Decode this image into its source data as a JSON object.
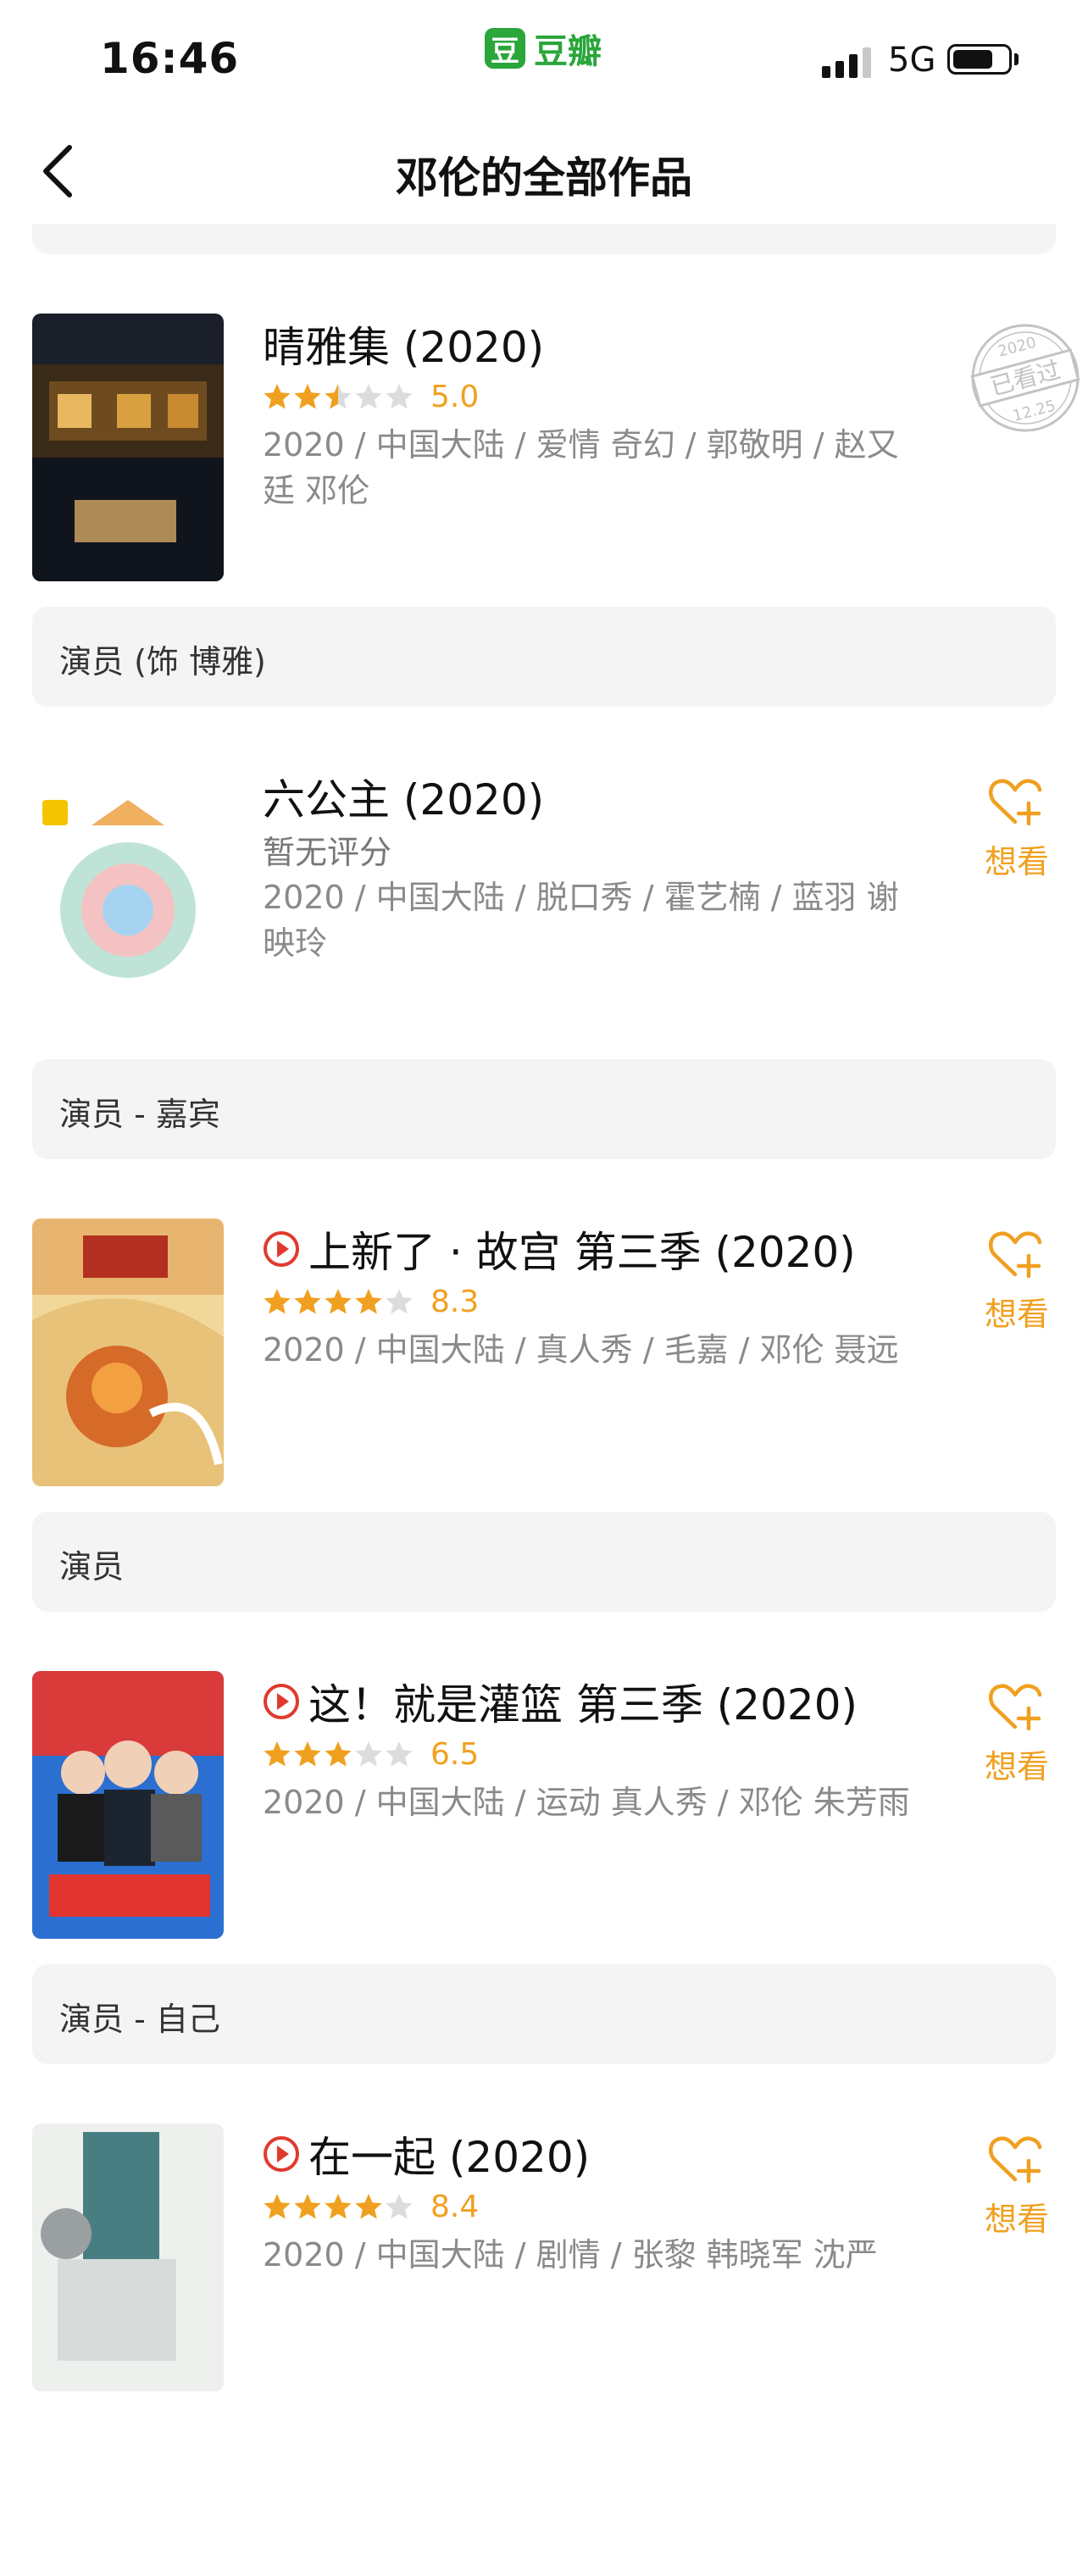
{
  "status_bar": {
    "time": "16:46",
    "app_logo_char": "豆",
    "app_name": "豆瓣",
    "network": "5G",
    "signal_bars": 3,
    "battery_level": 0.7
  },
  "header": {
    "title": "邓伦的全部作品",
    "back_icon": "chevron-left-icon"
  },
  "colors": {
    "accent_orange": "#f0a020",
    "play_red": "#e03a2f",
    "role_bg": "#f4f4f4",
    "douban_green": "#2aa63a"
  },
  "works": [
    {
      "title": "晴雅集 (2020)",
      "has_play": false,
      "rating_stars": 2.5,
      "score": "5.0",
      "no_rating_text": "",
      "meta": "2020 / 中国大陆 / 爱情 奇幻 / 郭敬明 / 赵又廷 邓伦",
      "action": "seen",
      "seen_stamp": {
        "year": "2020",
        "label": "已看过",
        "date": "12.25"
      },
      "want_label": "",
      "role": "演员 (饰 博雅)"
    },
    {
      "title": "六公主 (2020)",
      "has_play": false,
      "rating_stars": 0,
      "score": "",
      "no_rating_text": "暂无评分",
      "meta": "2020 / 中国大陆 / 脱口秀 / 霍艺楠 / 蓝羽 谢映玲",
      "action": "want",
      "want_label": "想看",
      "role": "演员 - 嘉宾"
    },
    {
      "title": "上新了 · 故宫 第三季 (2020)",
      "has_play": true,
      "rating_stars": 4,
      "score": "8.3",
      "no_rating_text": "",
      "meta": "2020 / 中国大陆 / 真人秀 / 毛嘉 / 邓伦 聂远",
      "action": "want",
      "want_label": "想看",
      "role": "演员"
    },
    {
      "title": "这！就是灌篮 第三季 (2020)",
      "has_play": true,
      "rating_stars": 3,
      "score": "6.5",
      "no_rating_text": "",
      "meta": "2020 / 中国大陆 / 运动 真人秀 / 邓伦 朱芳雨",
      "action": "want",
      "want_label": "想看",
      "role": "演员 - 自己"
    },
    {
      "title": "在一起 (2020)",
      "has_play": true,
      "rating_stars": 4,
      "score": "8.4",
      "no_rating_text": "",
      "meta": "2020 / 中国大陆 / 剧情 / 张黎 韩晓军 沈严",
      "action": "want",
      "want_label": "想看",
      "role": ""
    }
  ]
}
